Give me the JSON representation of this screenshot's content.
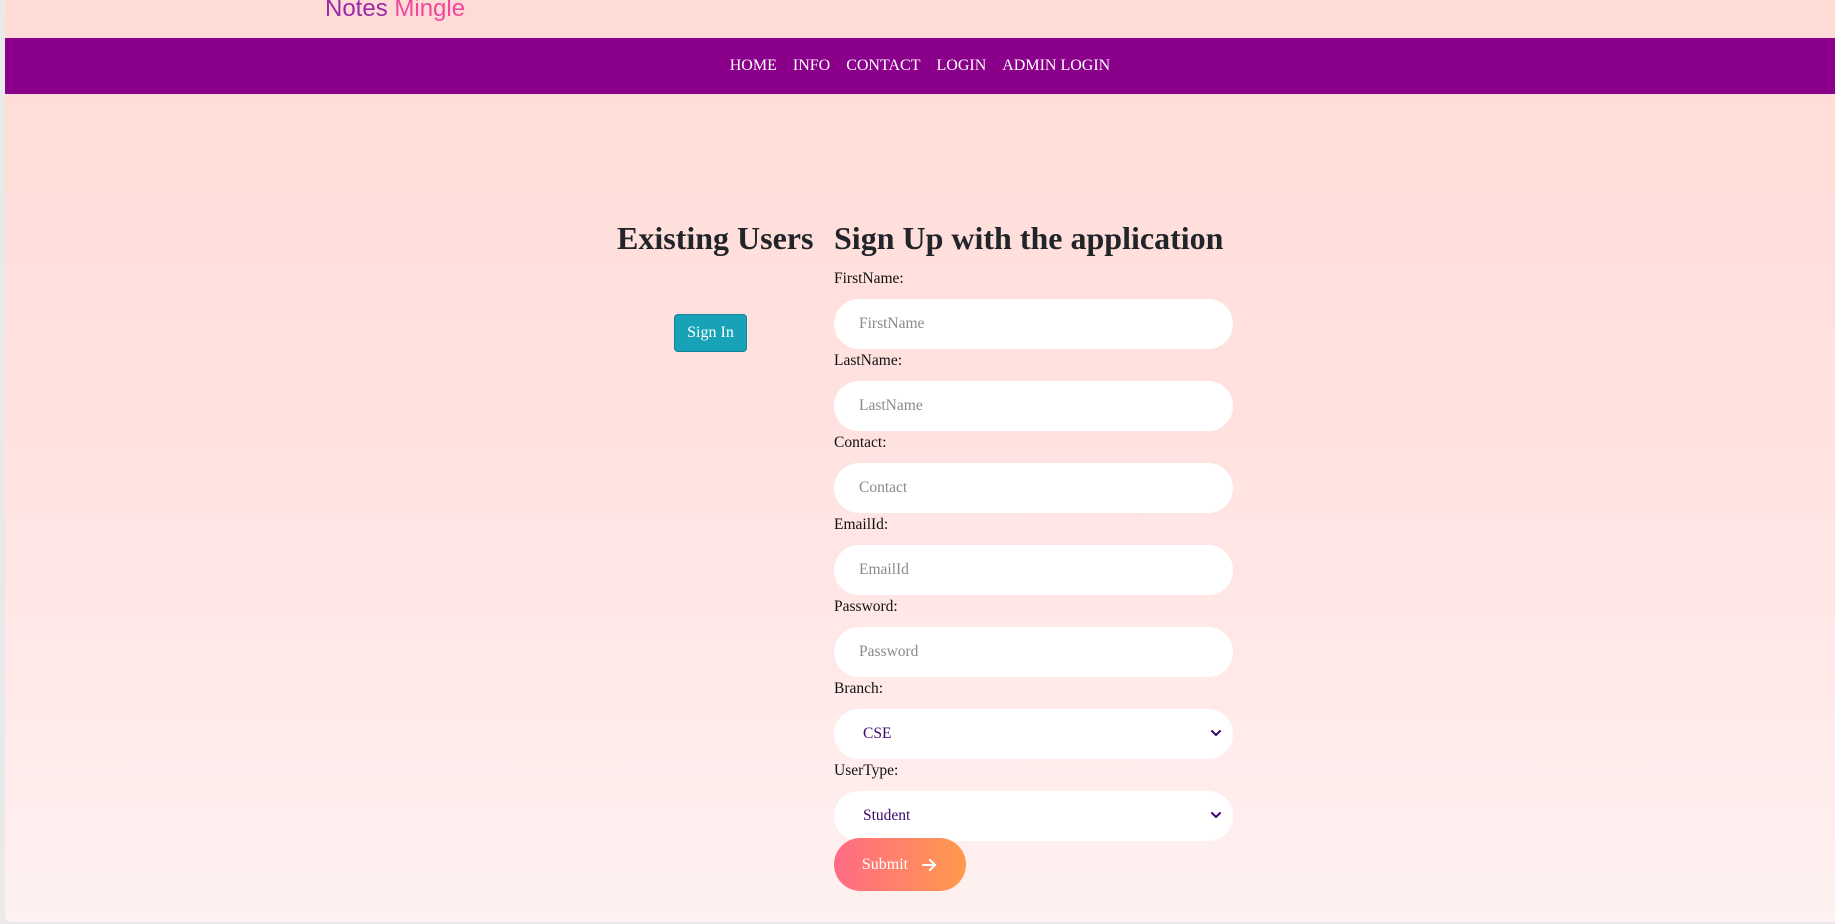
{
  "brand": {
    "part1": "Notes",
    "part2": "Mingle"
  },
  "nav": {
    "items": [
      "HOME",
      "INFO",
      "CONTACT",
      "LOGIN",
      "ADMIN LOGIN"
    ]
  },
  "existing": {
    "title": "Existing Users",
    "signin_label": "Sign In"
  },
  "signup": {
    "title": "Sign Up with the application",
    "fields": [
      {
        "label": "FirstName:",
        "placeholder": "FirstName",
        "value": ""
      },
      {
        "label": "LastName:",
        "placeholder": "LastName",
        "value": ""
      },
      {
        "label": "Contact:",
        "placeholder": "Contact",
        "value": ""
      },
      {
        "label": "EmailId:",
        "placeholder": "EmailId",
        "value": ""
      },
      {
        "label": "Password:",
        "placeholder": "Password",
        "value": ""
      }
    ],
    "branch": {
      "label": "Branch:",
      "selected": "CSE"
    },
    "usertype": {
      "label": "UserType:",
      "selected": "Student"
    },
    "submit_label": "Submit"
  },
  "colors": {
    "navbar": "#8b008b",
    "signin_button": "#17a2b8",
    "submit_gradient_start": "#ff6b85",
    "submit_gradient_end": "#ff9a4d",
    "brand_notes": "#9b2aa8",
    "brand_mingle": "#f0489e"
  }
}
